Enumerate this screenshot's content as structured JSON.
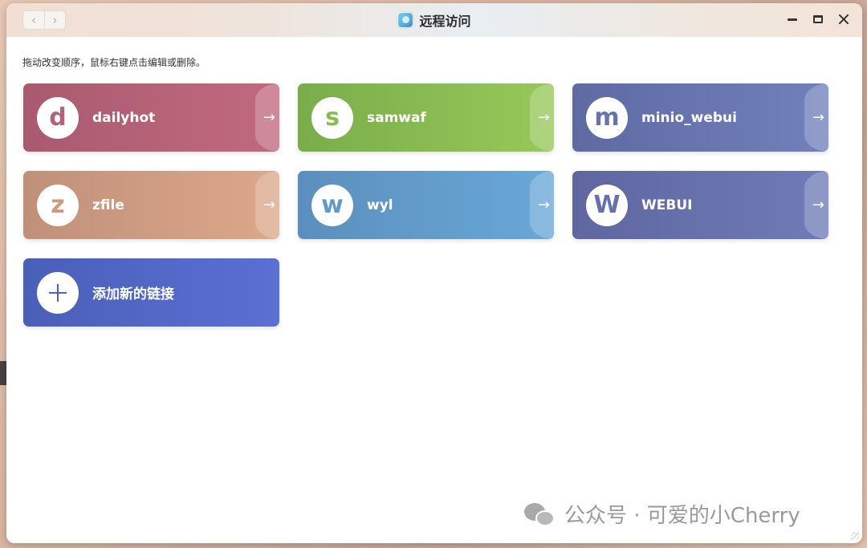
{
  "window": {
    "title": "远程访问",
    "app_icon": "remote-access-app-icon",
    "nav": {
      "back_icon": "chevron-left-icon",
      "forward_icon": "chevron-right-icon",
      "back_glyph": "‹",
      "forward_glyph": "›"
    },
    "controls": [
      "minimize-icon",
      "maximize-icon",
      "close-icon"
    ]
  },
  "hint": "拖动改变顺序，鼠标右键点击编辑或删除。",
  "links": [
    {
      "letter": "d",
      "name": "dailyhot",
      "color": "#b46277"
    },
    {
      "letter": "s",
      "name": "samwaf",
      "color": "#86bb4f"
    },
    {
      "letter": "m",
      "name": "minio_webui",
      "color": "#6873ad"
    },
    {
      "letter": "z",
      "name": "zfile",
      "color": "#d09a80"
    },
    {
      "letter": "w",
      "name": "wyl",
      "color": "#629bc9"
    },
    {
      "letter": "W",
      "name": "WEBUI",
      "color": "#6670aa"
    }
  ],
  "arrow_glyph": "→",
  "add_link": {
    "label": "添加新的链接",
    "icon": "plus-icon",
    "color": "#4e62c6"
  },
  "watermark": {
    "text": "公众号 · 可爱的小Cherry",
    "icon": "wechat-icon"
  }
}
